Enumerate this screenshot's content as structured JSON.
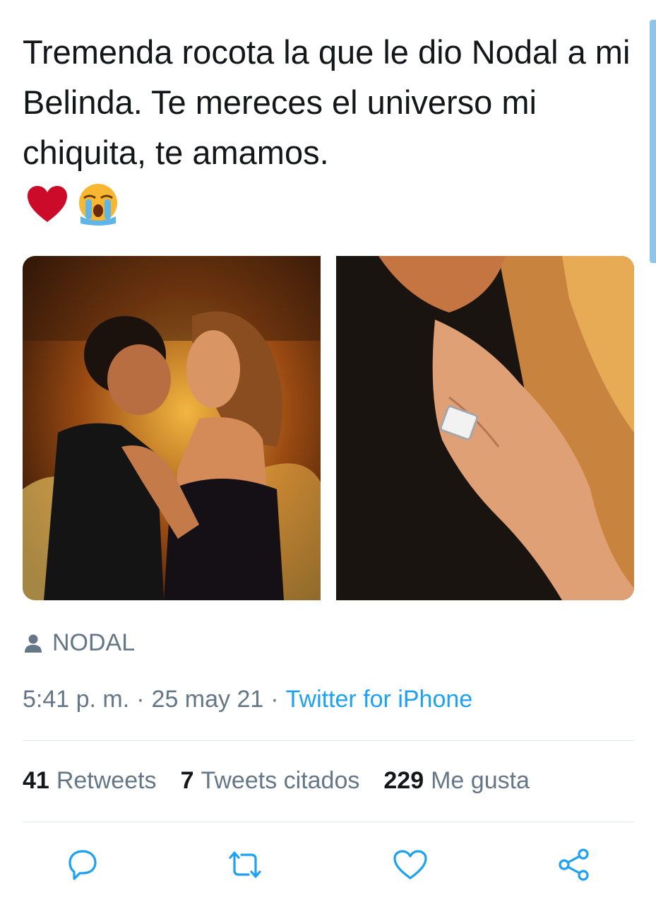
{
  "tweet": {
    "text": "Tremenda rocota la que le dio Nodal a mi Belinda. Te mereces el universo mi chiquita, te amamos.",
    "emoji": [
      "heart-icon",
      "loudly-crying-face-icon"
    ]
  },
  "media": {
    "tag_label": "NODAL"
  },
  "meta": {
    "time": "5:41 p. m.",
    "separator": "·",
    "date": "25 may 21",
    "source": "Twitter for iPhone"
  },
  "stats": {
    "retweets_count": "41",
    "retweets_label": "Retweets",
    "quotes_count": "7",
    "quotes_label": "Tweets citados",
    "likes_count": "229",
    "likes_label": "Me gusta"
  },
  "actions": [
    "reply-icon",
    "retweet-icon",
    "like-icon",
    "share-icon"
  ],
  "colors": {
    "link": "#1da1f2",
    "secondary_text": "#657786",
    "icon": "#1da1f2",
    "heart": "#cc0b2b"
  }
}
